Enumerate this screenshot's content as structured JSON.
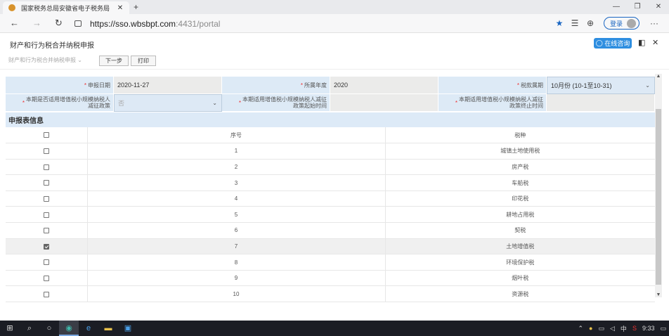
{
  "browser": {
    "tab_title": "国家税务总局安徽省电子税务局",
    "url_main": "https://sso.wbsbpt.com",
    "url_rest": ":4431/portal",
    "profile_label": "登录"
  },
  "page": {
    "title": "财产和行为税合并纳税申报",
    "chat_button": "在线咨询"
  },
  "toolbar": {
    "selector_label": "财产和行为税合并纳税申报",
    "next_label": "下一步",
    "print_label": "打印"
  },
  "form": {
    "row1": {
      "label1": "申报日期",
      "value1": "2020-11-27",
      "label2": "所属年度",
      "value2": "2020",
      "label3": "税款属期",
      "value3": "10月份 (10-1至10-31)"
    },
    "row2": {
      "label1_line1": "本期是否适用增值税小规模纳税人",
      "label1_line2": "减征政策",
      "value1": "否",
      "label2_line1": "本期适用增值税小规模纳税人减征",
      "label2_line2": "政策起始时间",
      "label3_line1": "本期适用增值税小规模纳税人减征",
      "label3_line2": "政策终止时间"
    }
  },
  "section_title": "申报表信息",
  "table": {
    "headers": {
      "index": "序号",
      "tax": "税种"
    },
    "rows": [
      {
        "index": "1",
        "tax": "城镇土地使用税",
        "checked": false
      },
      {
        "index": "2",
        "tax": "房产税",
        "checked": false
      },
      {
        "index": "3",
        "tax": "车船税",
        "checked": false
      },
      {
        "index": "4",
        "tax": "印花税",
        "checked": false
      },
      {
        "index": "5",
        "tax": "耕地占用税",
        "checked": false
      },
      {
        "index": "6",
        "tax": "契税",
        "checked": false
      },
      {
        "index": "7",
        "tax": "土地增值税",
        "checked": true
      },
      {
        "index": "8",
        "tax": "环境保护税",
        "checked": false
      },
      {
        "index": "9",
        "tax": "烟叶税",
        "checked": false
      },
      {
        "index": "10",
        "tax": "资源税",
        "checked": false
      }
    ]
  },
  "taskbar": {
    "ime": "中",
    "time": "9:33"
  }
}
